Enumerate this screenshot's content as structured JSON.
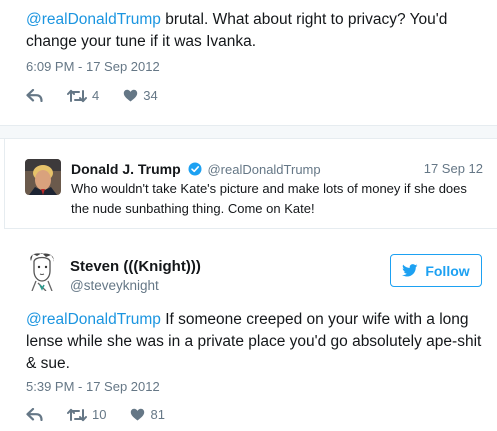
{
  "tweet1": {
    "mention": "@realDonaldTrump",
    "text": " brutal. What about right to privacy? You'd change your tune if it was Ivanka.",
    "timestamp": "6:09 PM - 17 Sep 2012",
    "retweets": "4",
    "likes": "34"
  },
  "quoted_tweet": {
    "name": "Donald J. Trump",
    "handle": "@realDonaldTrump",
    "date": "17 Sep 12",
    "text": "Who wouldn't take Kate's picture and make lots of money if she does the nude sunbathing thing. Come on Kate!"
  },
  "tweet2": {
    "name": "Steven (((Knight)))",
    "handle": "@steveyknight",
    "follow_label": "Follow",
    "mention": "@realDonaldTrump",
    "text": " If someone creeped on your wife with a long lense while she was in a private place you'd go absolutely ape-shit & sue.",
    "timestamp": "5:39 PM - 17 Sep 2012",
    "retweets": "10",
    "likes": "81"
  },
  "colors": {
    "link": "#1b95e0",
    "muted": "#657786",
    "follow": "#1da1f2",
    "verified": "#1da1f2"
  },
  "icons": [
    "reply-icon",
    "retweet-icon",
    "like-icon",
    "verified-icon",
    "twitter-bird-icon"
  ]
}
